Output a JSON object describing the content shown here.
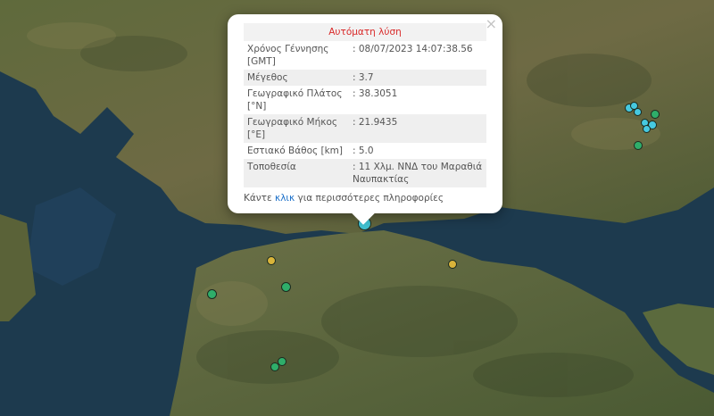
{
  "popup": {
    "header": "Αυτόματη λύση",
    "close_glyph": "×",
    "rows": [
      {
        "label": "Χρόνος Γέννησης [GMT]",
        "value": ": 08/07/2023 14:07:38.56"
      },
      {
        "label": "Μέγεθος",
        "value": ": 3.7"
      },
      {
        "label": "Γεωγραφικό Πλάτος [°N]",
        "value": ": 38.3051"
      },
      {
        "label": "Γεωγραφικό Μήκος [°E]",
        "value": ": 21.9435"
      },
      {
        "label": "Εστιακό Βάθος [km]",
        "value": ": 5.0"
      },
      {
        "label": "Τοποθεσία",
        "value": ": 11 Χλμ. ΝΝΔ του Μαραθιά Ναυπακτίας"
      }
    ],
    "footer": {
      "before": "Κάντε ",
      "link": "κλικ",
      "after": " για περισσότερες πληροφορίες"
    }
  },
  "colors": {
    "marker_green": "#2fae6a",
    "marker_yellow": "#d9b43a",
    "marker_cyan": "#46c9e0",
    "marker_selected": "#3fc0d0",
    "popup_header": "#d92a2a",
    "link": "#1a6fc9"
  }
}
